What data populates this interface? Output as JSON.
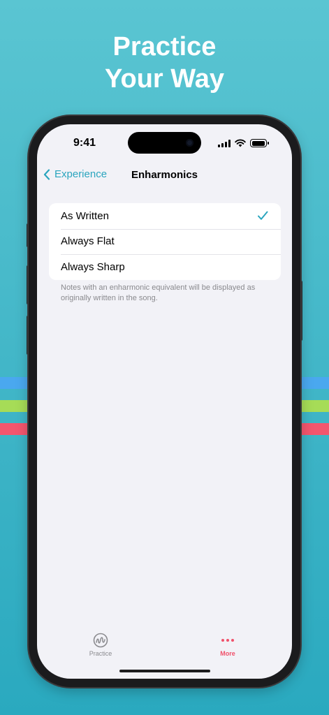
{
  "headline": {
    "line1": "Practice",
    "line2": "Your Way"
  },
  "status_bar": {
    "time": "9:41"
  },
  "nav": {
    "back_label": "Experience",
    "title": "Enharmonics"
  },
  "options": [
    {
      "label": "As Written",
      "selected": true
    },
    {
      "label": "Always Flat",
      "selected": false
    },
    {
      "label": "Always Sharp",
      "selected": false
    }
  ],
  "footnote": "Notes with an enharmonic equivalent will be displayed as originally written in the song.",
  "tab_bar": {
    "items": [
      {
        "label": "Practice",
        "icon": "practice-icon",
        "active": false
      },
      {
        "label": "More",
        "icon": "more-dots-icon",
        "active": true
      }
    ]
  },
  "colors": {
    "background_top": "#5ac5d2",
    "background_bottom": "#2aa9bf",
    "accent": "#2aa5be",
    "tab_active": "#f0506a",
    "stripe_blue": "#4aa8ef",
    "stripe_green": "#a6dc57",
    "stripe_red": "#f3566e"
  }
}
